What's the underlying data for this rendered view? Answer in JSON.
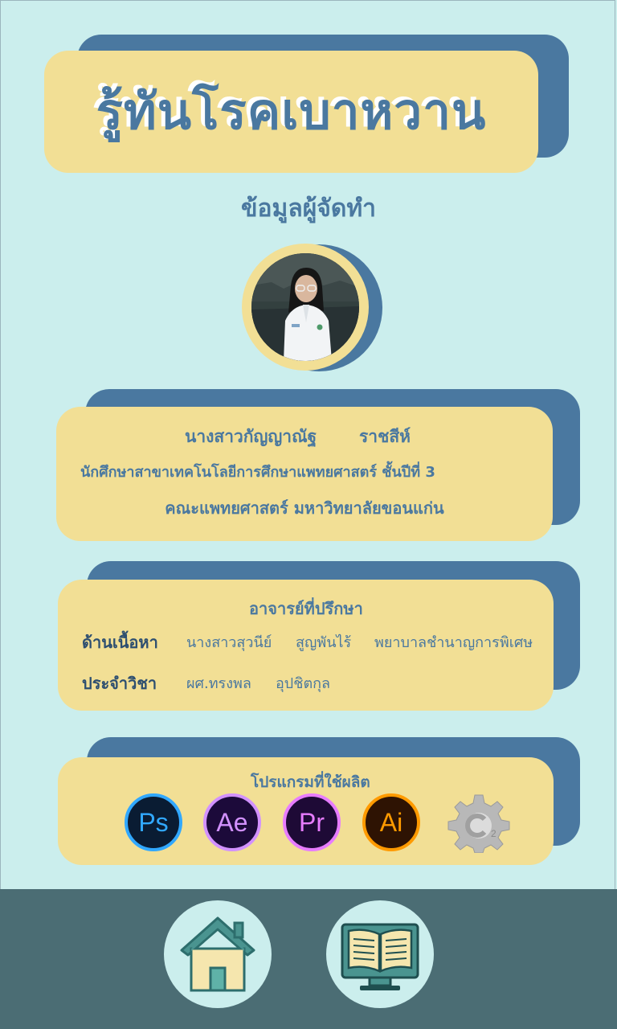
{
  "title": "รู้ทันโรคเบาหวาน",
  "subtitle": "ข้อมูลผู้จัดทำ",
  "author": {
    "name_first": "นางสาวกัญญาณัฐ",
    "name_last": "ราชสีห์",
    "program_line": "นักศึกษาสาขาเทคโนโลยีการศึกษาแพทยศาสตร์  ชั้นปีที่ 3",
    "faculty_line": "คณะแพทยศาสตร์ มหาวิทยาลัยขอนแก่น"
  },
  "advisors": {
    "heading": "อาจารย์ที่ปรึกษา",
    "content_label": "ด้านเนื้อหา",
    "content_name": "นางสาวสุวนีย์",
    "content_surname": "สูญพันไร้",
    "content_position": "พยาบาลชำนาญการพิเศษ",
    "subject_label": "ประจำวิชา",
    "subject_name": "ผศ.ทรงพล",
    "subject_surname": "อุปชิตกุล"
  },
  "programs": {
    "heading": "โปรแกรมที่ใช้ผลิต",
    "icons": [
      {
        "name": "photoshop-icon",
        "label": "Ps",
        "color": "#31a8ff"
      },
      {
        "name": "after-effects-icon",
        "label": "Ae",
        "color": "#d291ff"
      },
      {
        "name": "premiere-icon",
        "label": "Pr",
        "color": "#e77cff"
      },
      {
        "name": "illustrator-icon",
        "label": "Ai",
        "color": "#ff9a00"
      },
      {
        "name": "construct2-icon",
        "label": "",
        "color": "#b5b5b5"
      }
    ]
  },
  "nav": {
    "home_icon": "home-icon",
    "book_icon": "ebook-icon"
  },
  "colors": {
    "background": "#cbeeed",
    "card": "#f2df95",
    "accent": "#4a78a0",
    "bottom_bar": "#4b6d74"
  }
}
